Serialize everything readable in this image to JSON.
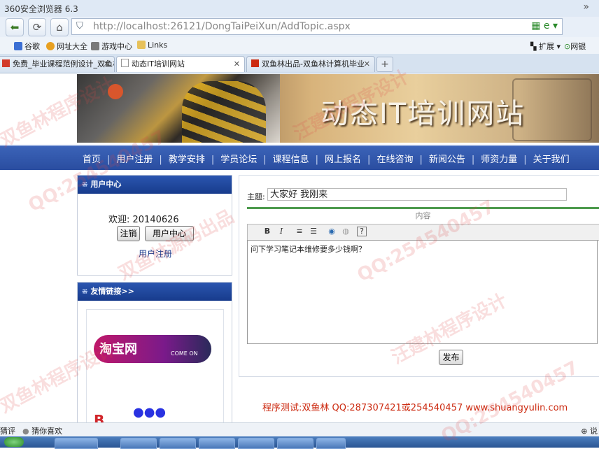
{
  "browser": {
    "title": "360安全浏览器 6.3",
    "chevron": "»",
    "url_host": "http://localhost",
    "url_rest": ":26121/DongTaiPeiXun/AddTopic.aspx",
    "address_icons": "▦ e ▾"
  },
  "bookmarks": [
    {
      "label": "谷歌",
      "color": "#3b6fd4"
    },
    {
      "label": "网址大全",
      "color": "#e8a020"
    },
    {
      "label": "游戏中心",
      "color": "#7a7a7a"
    },
    {
      "label": "Links",
      "color": "#e7c15a"
    }
  ],
  "bookmarks_right": {
    "ext": "扩展",
    "bank": "网银"
  },
  "tabs": [
    {
      "label": "免费_毕业课程范例设计_双鱼林",
      "active": false
    },
    {
      "label": "动态IT培训网站",
      "active": true
    },
    {
      "label": "双鱼林出品-双鱼林计算机毕业",
      "active": false
    }
  ],
  "banner_title": "动态IT培训网站",
  "menu": [
    "首页",
    "用户注册",
    "教学安排",
    "学员论坛",
    "课程信息",
    "网上报名",
    "在线咨询",
    "新闻公告",
    "师资力量",
    "关于我们"
  ],
  "user_center": {
    "title": "用户中心",
    "welcome": "欢迎: 20140626",
    "logout": "注销",
    "center_btn": "用户中心",
    "register_link": "用户注册"
  },
  "friend_links": {
    "title": "友情链接>>",
    "taobao": "淘宝网",
    "taobao_sub": "COME ON"
  },
  "topic_form": {
    "subject_label": "主题:",
    "subject_value": "大家好  我刚来",
    "content_label": "内容",
    "content_text": "问下学习笔记本维修要多少钱啊？",
    "submit": "发布",
    "toolbar": [
      "B",
      "I",
      "≡",
      "☰",
      "◉",
      "◍",
      "?"
    ]
  },
  "footer": "程序测试:双鱼林 QQ:287307421或254540457 www.shuangyulin.com",
  "statusbar": {
    "left": "猜评",
    "item": "猜你喜欢",
    "right": "⊕ 说"
  },
  "watermarks": [
    "双鱼林程序设计",
    "QQ:254540457",
    "汪建林程序设计",
    "双鱼林源码出品",
    "QQ:254540457",
    "汪建林程序设计",
    "双鱼林程序设计",
    "QQ:254540457"
  ],
  "colors": {
    "menu_bg": "#2a4da0",
    "footer_text": "#cc2a10",
    "panel_head": "#173b8c"
  }
}
